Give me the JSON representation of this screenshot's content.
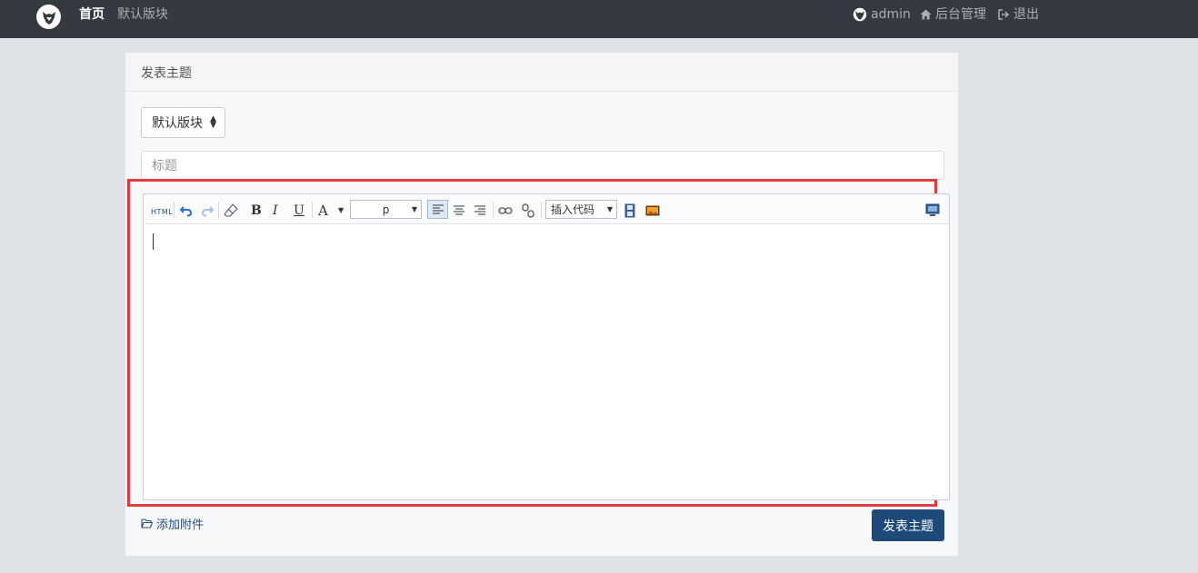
{
  "navbar": {
    "home": "首页",
    "forum": "默认版块",
    "user": "admin",
    "admin": "后台管理",
    "logout": "退出"
  },
  "card": {
    "header": "发表主题"
  },
  "form": {
    "forum_select": "默认版块",
    "title_placeholder": "标题"
  },
  "toolbar": {
    "html_label": "HTML",
    "bold": "B",
    "italic": "I",
    "underline": "U",
    "font_color": "A",
    "paragraph": "p",
    "insert_code": "插入代码"
  },
  "footer": {
    "attach": "添加附件",
    "submit": "发表主题"
  },
  "colors": {
    "navbar_bg": "#353a40",
    "primary_button": "#1e4a7a",
    "highlight_border": "#e03c3f"
  }
}
